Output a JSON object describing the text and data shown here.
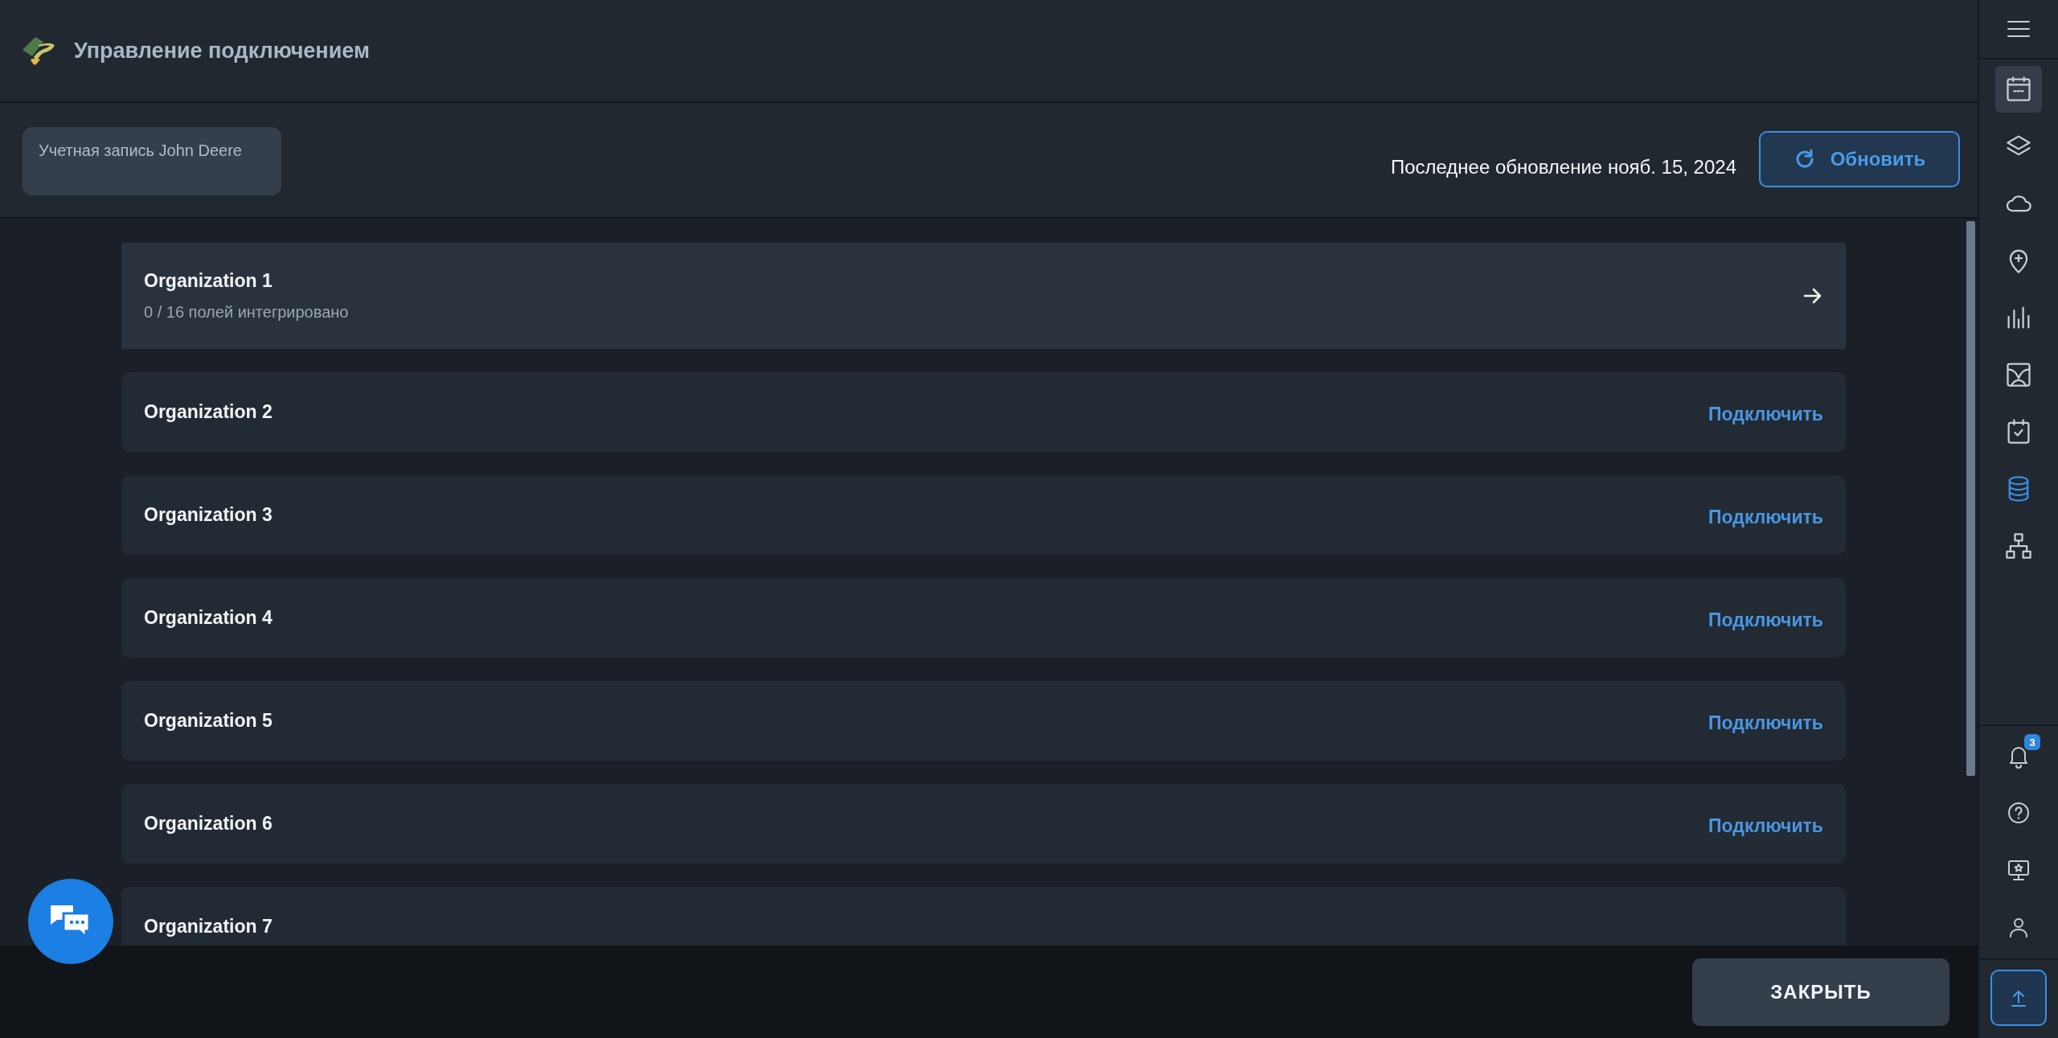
{
  "app": {
    "title": "Управление подключением"
  },
  "toolbar": {
    "account": "Учетная запись John Deere",
    "last_update": "Последнее обновление нояб. 15, 2024",
    "refresh_button": "Обновить"
  },
  "organizations": [
    {
      "kind": "integrated",
      "name": "Organization 1",
      "subtitle": "0 / 16 полей интегрировано"
    },
    {
      "kind": "connect",
      "name": "Organization 2",
      "action": "Подключить"
    },
    {
      "kind": "connect",
      "name": "Organization 3",
      "action": "Подключить"
    },
    {
      "kind": "connect",
      "name": "Organization 4",
      "action": "Подключить"
    },
    {
      "kind": "connect",
      "name": "Organization 5",
      "action": "Подключить"
    },
    {
      "kind": "connect",
      "name": "Organization 6",
      "action": "Подключить"
    },
    {
      "kind": "connect",
      "name": "Organization 7"
    }
  ],
  "footer": {
    "close_button": "ЗАКРЫТЬ"
  },
  "sidebar": {
    "items": [
      {
        "selected": true,
        "active": false
      },
      {
        "selected": false,
        "active": false
      },
      {
        "selected": false,
        "active": false
      },
      {
        "selected": false,
        "active": false
      },
      {
        "selected": false,
        "active": false
      },
      {
        "selected": false,
        "active": false
      },
      {
        "selected": false,
        "active": false
      },
      {
        "selected": false,
        "active": true
      },
      {
        "selected": false,
        "active": false
      }
    ],
    "notification_badge": "3"
  }
}
